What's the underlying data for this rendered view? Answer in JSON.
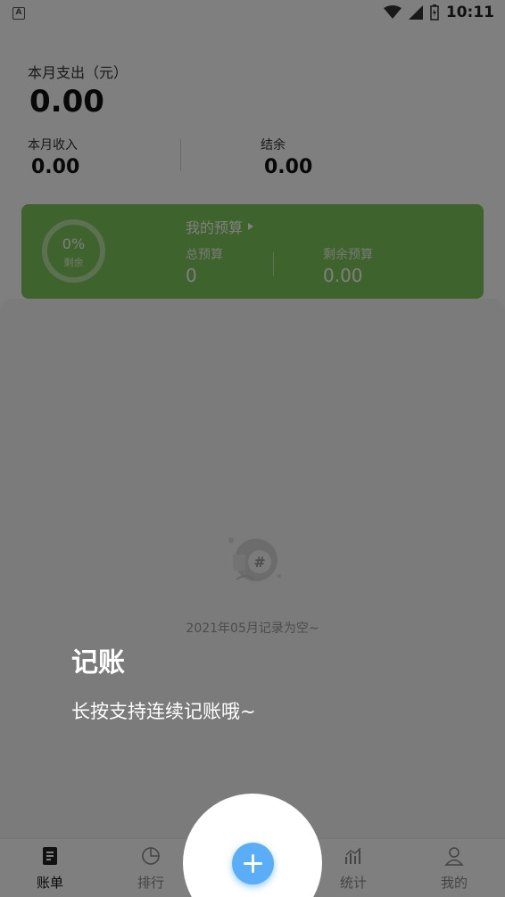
{
  "status_bar": {
    "left_badge": "A",
    "time": "10:11"
  },
  "summary": {
    "expense_label": "本月支出（元）",
    "expense_value": "0.00",
    "income_label": "本月收入",
    "income_value": "0.00",
    "balance_label": "结余",
    "balance_value": "0.00"
  },
  "budget": {
    "percent": "0%",
    "percent_sub": "剩余",
    "title": "我的预算",
    "total_label": "总预算",
    "total_value": "0",
    "remain_label": "剩余预算",
    "remain_value": "0.00",
    "color": "#7fc65a"
  },
  "empty_state": {
    "icon": "notebook-hash-icon",
    "text": "2021年05月记录为空~"
  },
  "tabs": [
    {
      "label": "账单",
      "icon": "bill-icon",
      "active": true
    },
    {
      "label": "排行",
      "icon": "pie-chart-icon",
      "active": false
    },
    {
      "label": "统计",
      "icon": "stats-icon",
      "active": false
    },
    {
      "label": "我的",
      "icon": "user-icon",
      "active": false
    }
  ],
  "add_button": {
    "icon": "plus-icon",
    "color": "#5aaef8"
  },
  "guide": {
    "title": "记账",
    "description": "长按支持连续记账哦~"
  }
}
